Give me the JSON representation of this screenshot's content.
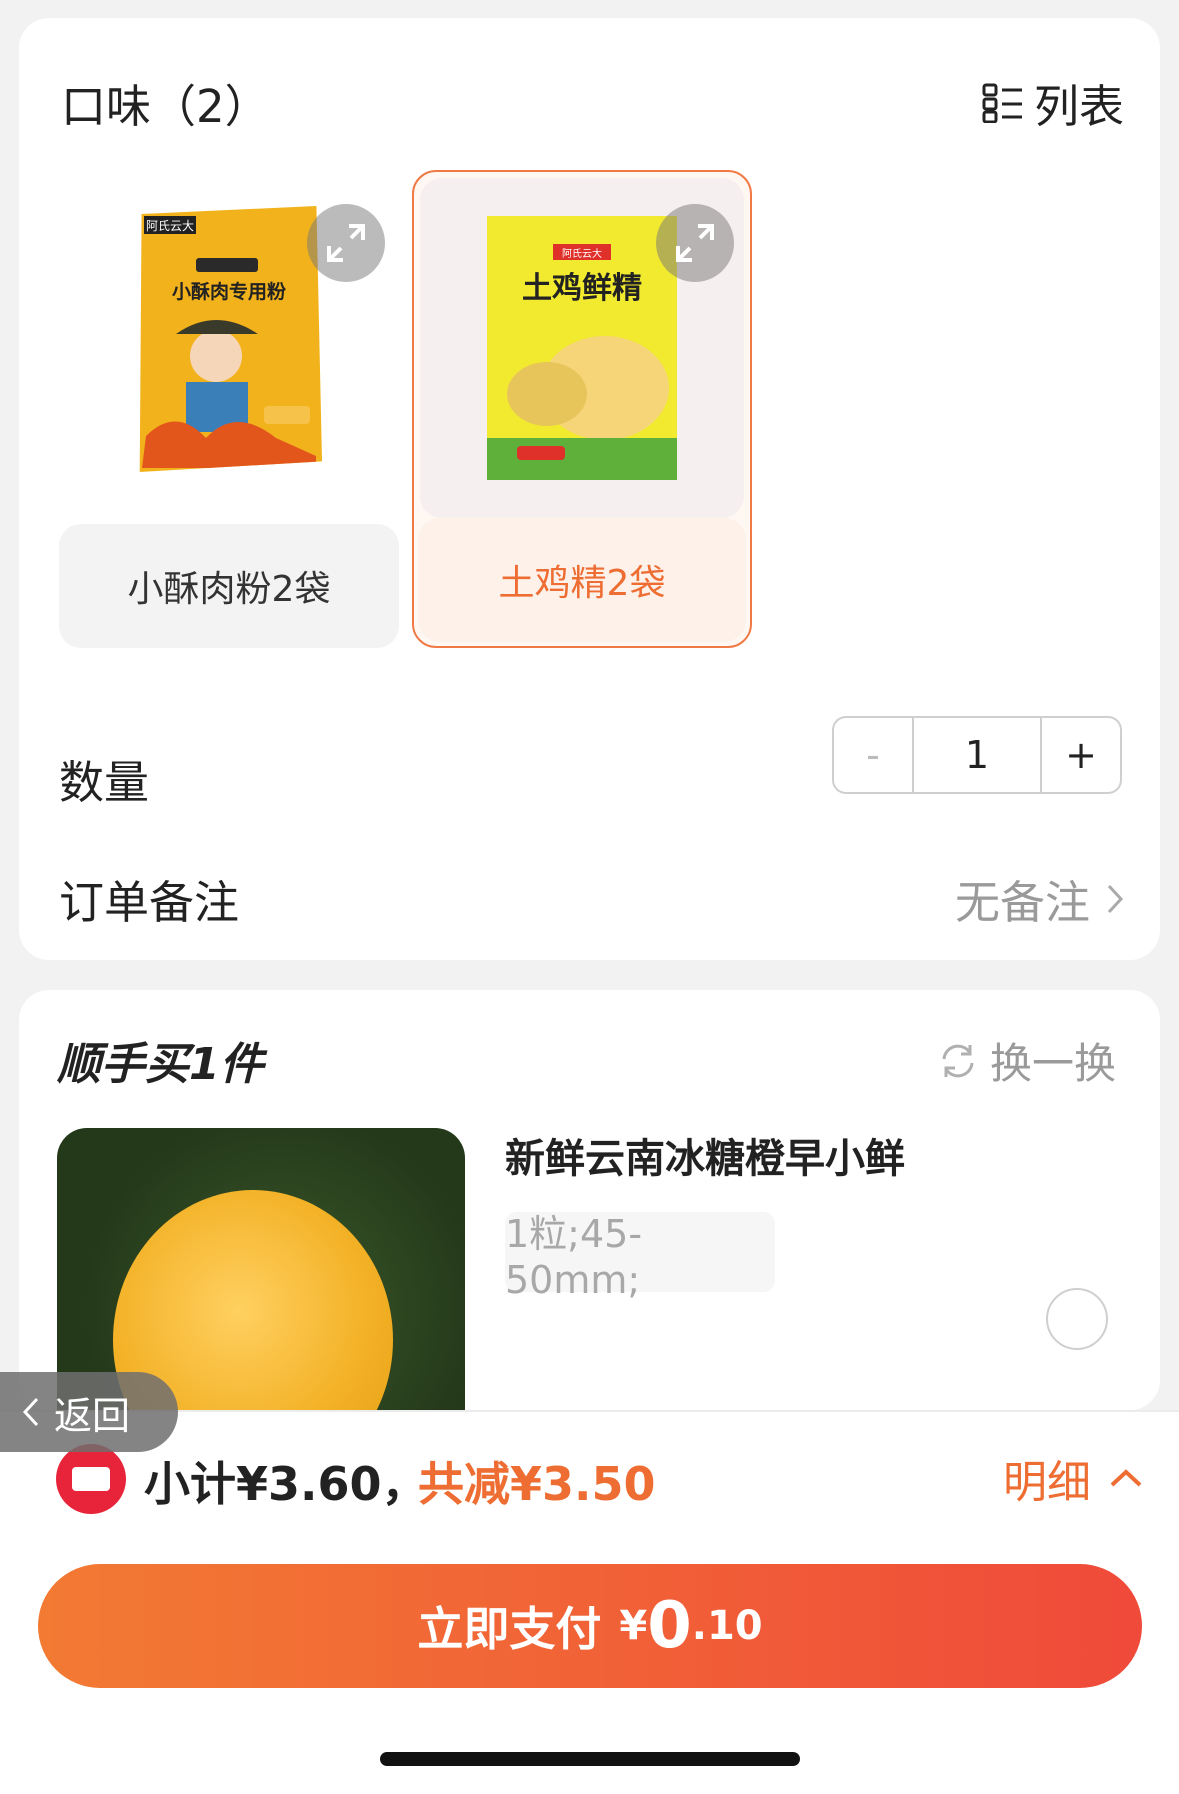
{
  "flavor": {
    "title": "口味（2）",
    "list_label": "列表"
  },
  "options": [
    {
      "label": "小酥肉粉2袋",
      "selected": false,
      "pkg_text": "小酥肉专用粉",
      "brand": "阿氏云大"
    },
    {
      "label": "土鸡精2袋",
      "selected": true,
      "pkg_text": "土鸡鲜精",
      "brand": "阿氏云大"
    }
  ],
  "quantity": {
    "label": "数量",
    "minus": "-",
    "value": "1",
    "plus": "+"
  },
  "note": {
    "label": "订单备注",
    "value": "无备注"
  },
  "bundle": {
    "title": "顺手买1件",
    "swap_label": "换一换",
    "product": {
      "name": "新鲜云南冰糖橙早小鲜",
      "spec": "1粒;45-50mm;"
    }
  },
  "back": {
    "label": "返回"
  },
  "summary": {
    "subtotal": "小计¥3.60，",
    "discount": "共减¥3.50",
    "detail": "明细"
  },
  "pay": {
    "label": "立即支付",
    "currency": "¥",
    "amount_int": "0",
    "amount_dec": ".10"
  },
  "colors": {
    "accent": "#ee6d33",
    "pay_start": "#f27a33",
    "pay_end": "#f04a3a",
    "coupon": "#e8243b"
  }
}
